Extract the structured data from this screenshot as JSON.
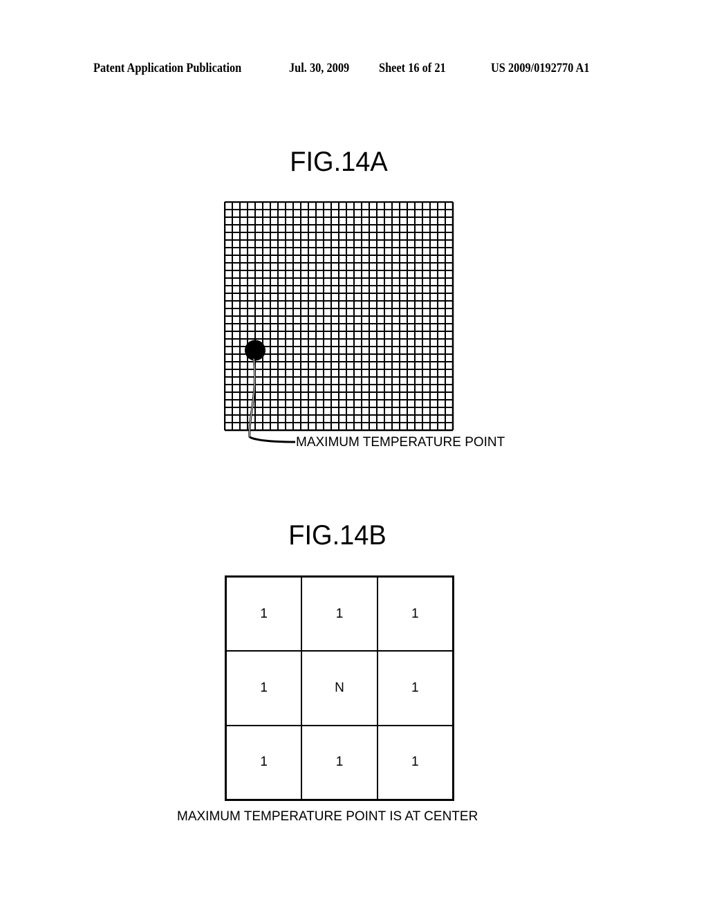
{
  "header": {
    "publication": "Patent Application Publication",
    "date": "Jul. 30, 2009",
    "sheet": "Sheet 16 of 21",
    "number": "US 2009/0192770 A1"
  },
  "fig14a": {
    "title": "FIG.14A",
    "grid_columns": 30,
    "grid_rows": 30,
    "max_point_cell": {
      "column": 3,
      "row": 20
    },
    "callout_label": "MAXIMUM TEMPERATURE POINT"
  },
  "fig14b": {
    "title": "FIG.14B",
    "cells": [
      [
        "1",
        "1",
        "1"
      ],
      [
        "1",
        "N",
        "1"
      ],
      [
        "1",
        "1",
        "1"
      ]
    ],
    "caption": "MAXIMUM TEMPERATURE POINT IS AT CENTER"
  }
}
